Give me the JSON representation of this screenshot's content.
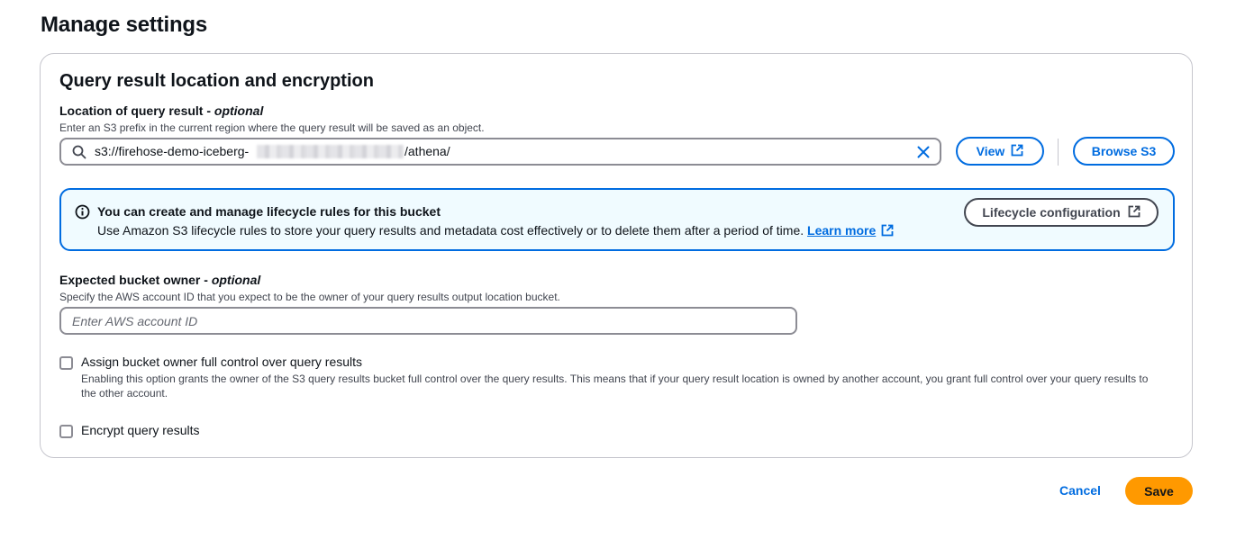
{
  "page": {
    "title": "Manage settings"
  },
  "section": {
    "title": "Query result location and encryption",
    "location": {
      "label": "Location of query result - ",
      "optional": "optional",
      "description": "Enter an S3 prefix in the current region where the query result will be saved as an object.",
      "value_prefix": "s3://firehose-demo-iceberg-",
      "value_suffix": "/athena/",
      "view_label": "View",
      "browse_label": "Browse S3"
    },
    "alert": {
      "title": "You can create and manage lifecycle rules for this bucket",
      "body": "Use Amazon S3 lifecycle rules to store your query results and metadata cost effectively or to delete them after a period of time. ",
      "link": "Learn more",
      "button": "Lifecycle configuration"
    },
    "owner": {
      "label": "Expected bucket owner - ",
      "optional": "optional",
      "description": "Specify the AWS account ID that you expect to be the owner of your query results output location bucket.",
      "placeholder": "Enter AWS account ID",
      "value": ""
    },
    "full_control": {
      "label": "Assign bucket owner full control over query results",
      "description": "Enabling this option grants the owner of the S3 query results bucket full control over the query results. This means that if your query result location is owned by another account, you grant full control over your query results to the other account.",
      "checked": false
    },
    "encrypt": {
      "label": "Encrypt query results",
      "checked": false
    }
  },
  "footer": {
    "cancel_label": "Cancel",
    "save_label": "Save"
  },
  "colors": {
    "link": "#006ce0",
    "primary": "#ff9900",
    "alert_bg": "#f0fbff",
    "border": "#c6c6cd"
  },
  "icons": [
    "search-icon",
    "clear-icon",
    "external-link-icon",
    "info-icon"
  ]
}
